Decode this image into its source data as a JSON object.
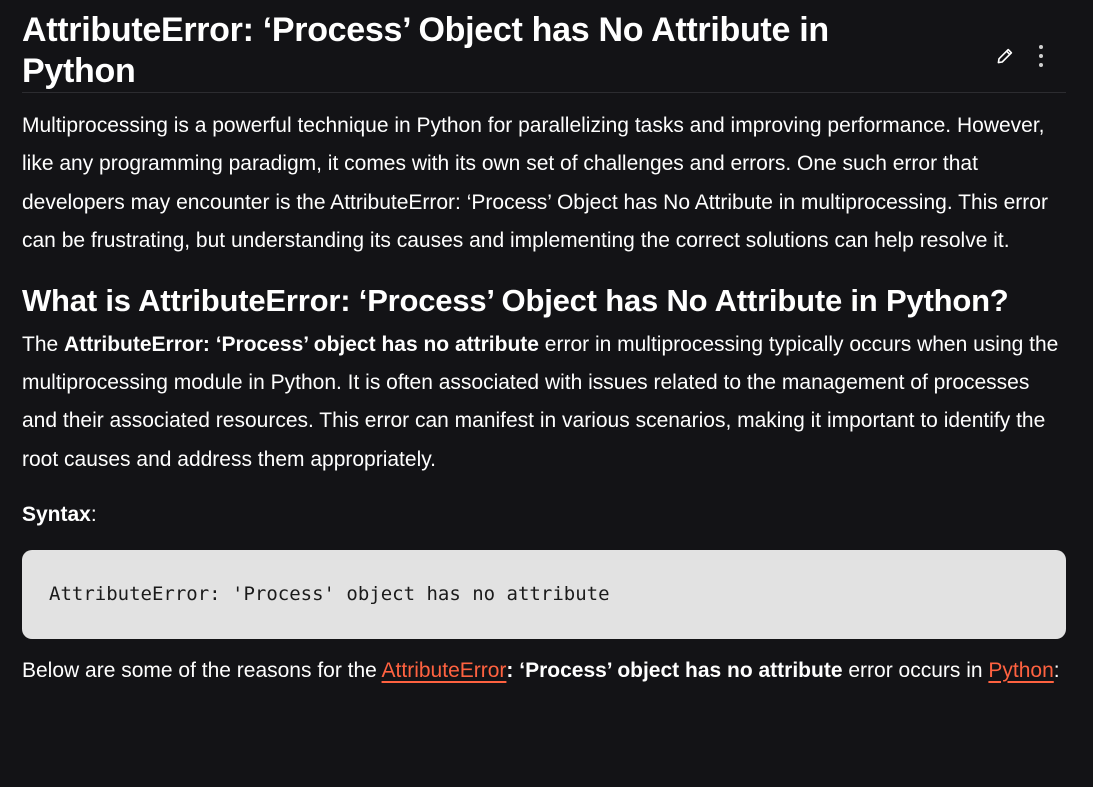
{
  "article": {
    "title": "AttributeError: ‘Process’ Object has No Attribute in Python",
    "actions": {
      "edit_icon": "pencil-icon",
      "more_icon": "vertical-dots-icon"
    },
    "intro": "Multiprocessing is a powerful technique in Python for parallelizing tasks and improving performance. However, like any programming paradigm, it comes with its own set of challenges and errors. One such error that developers may encounter is the AttributeError: ‘Process’ Object has No Attribute in multiprocessing. This error can be frustrating, but understanding its causes and implementing the correct solutions can help resolve it.",
    "section_heading": "What is AttributeError: ‘Process’ Object has No Attribute in Python?",
    "desc": {
      "prefix": "The ",
      "bold": "AttributeError: ‘Process’ object has no attribute",
      "rest": " error in multiprocessing typically occurs when using the multiprocessing module in Python. It is often associated with issues related to the management of processes and their associated resources. This error can manifest in various scenarios, making it important to identify the root causes and address them appropriately."
    },
    "syntax": {
      "label": "Syntax",
      "colon": ":"
    },
    "code": "AttributeError: 'Process' object has no attribute",
    "reasons": {
      "prefix": "Below are some of the reasons for the ",
      "link1": "AttributeError",
      "bold": ": ‘Process’ object has no attribute",
      "middle": " error occurs in ",
      "link2": "Python",
      "suffix": ":"
    }
  },
  "colors": {
    "background": "#131316",
    "text": "#ffffff",
    "link": "#ff6240",
    "code_background": "#e2e2e2"
  }
}
